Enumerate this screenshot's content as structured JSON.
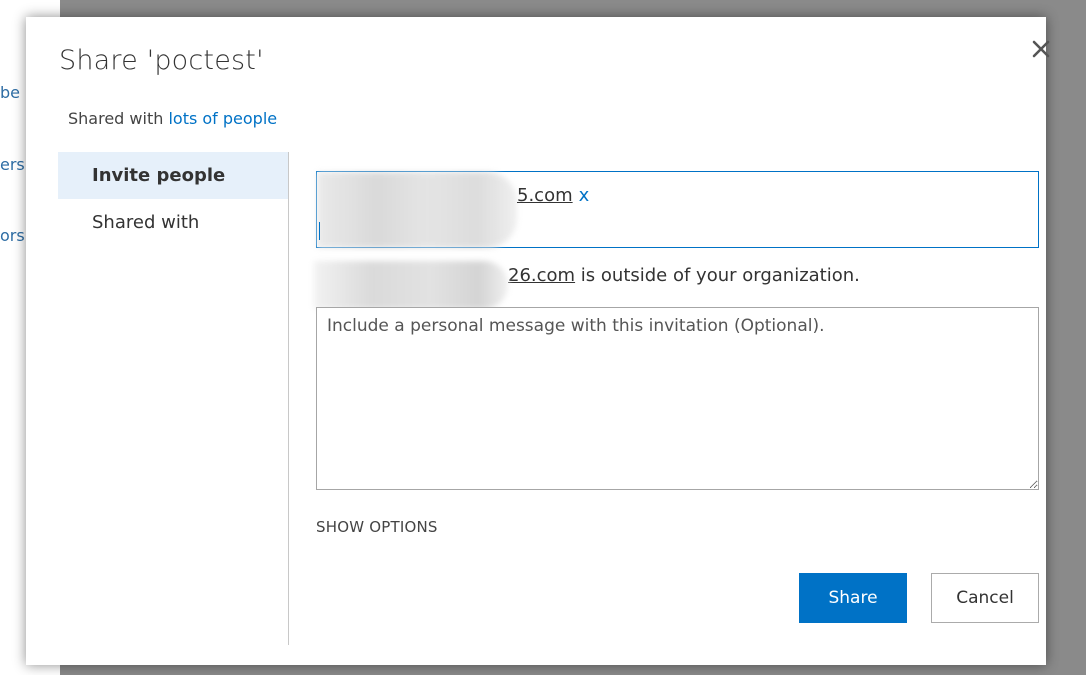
{
  "background": {
    "items": [
      "be",
      "ers",
      "ors"
    ]
  },
  "dialog": {
    "title": "Share 'poctest'",
    "shared_prefix": "Shared with",
    "shared_link": "lots of people",
    "nav": [
      {
        "label": "Invite people",
        "active": true
      },
      {
        "label": "Shared with",
        "active": false
      }
    ],
    "invite": {
      "email_tag": "5.com",
      "remove_label": "x",
      "warning_addr": "26.com",
      "warning_text": " is outside of your organization.",
      "message_placeholder": "Include a personal message with this invitation (Optional).",
      "show_options": "SHOW OPTIONS"
    },
    "buttons": {
      "share": "Share",
      "cancel": "Cancel"
    }
  },
  "colors": {
    "accent": "#0072c6",
    "nav_active_bg": "#e6f0fa"
  },
  "icons": {
    "close": "close-icon"
  }
}
